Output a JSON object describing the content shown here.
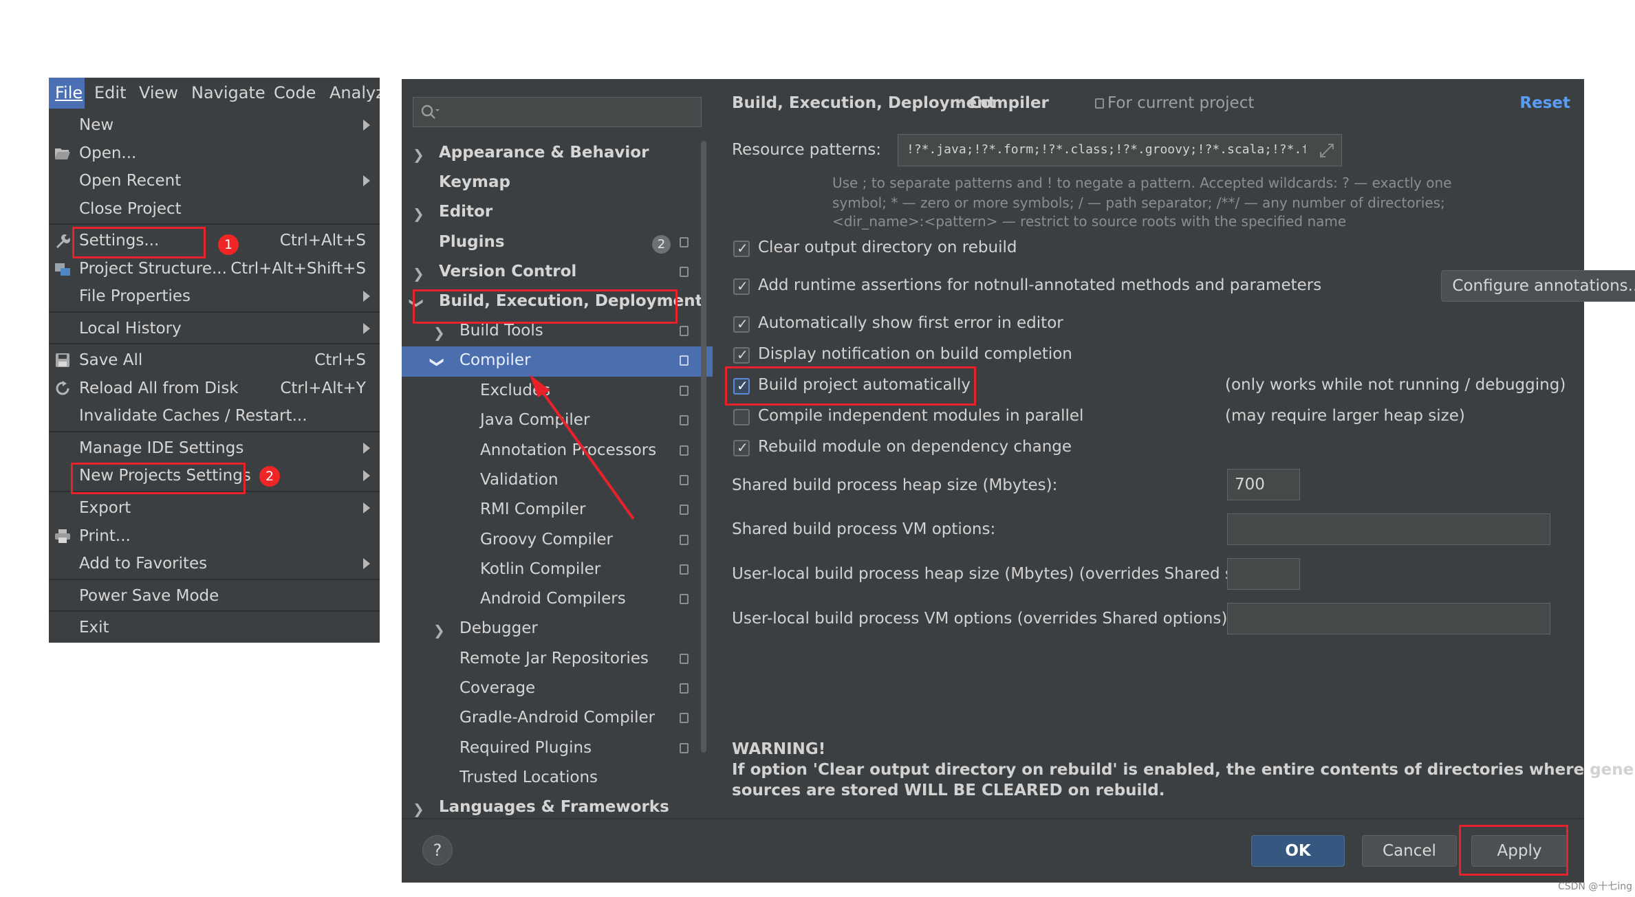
{
  "menu_bar": [
    "File",
    "Edit",
    "View",
    "Navigate",
    "Code",
    "Analyze"
  ],
  "file_menu": {
    "items": {
      "new": "New",
      "open": "Open...",
      "open_recent": "Open Recent",
      "close_project": "Close Project",
      "settings": "Settings...",
      "settings_shortcut": "Ctrl+Alt+S",
      "project_structure": "Project Structure...",
      "project_structure_shortcut": "Ctrl+Alt+Shift+S",
      "file_properties": "File Properties",
      "local_history": "Local History",
      "save_all": "Save All",
      "save_all_shortcut": "Ctrl+S",
      "reload": "Reload All from Disk",
      "reload_shortcut": "Ctrl+Alt+Y",
      "invalidate": "Invalidate Caches / Restart...",
      "manage_ide": "Manage IDE Settings",
      "new_projects": "New Projects Settings",
      "export": "Export",
      "print": "Print...",
      "favorites": "Add to Favorites",
      "power_save": "Power Save Mode",
      "exit": "Exit"
    },
    "badges": [
      "1",
      "2"
    ]
  },
  "tree": {
    "appearance": "Appearance & Behavior",
    "keymap": "Keymap",
    "editor": "Editor",
    "plugins": "Plugins",
    "plugins_badge": "2",
    "vcs": "Version Control",
    "build": "Build, Execution, Deployment",
    "build_tools": "Build Tools",
    "compiler": "Compiler",
    "excludes": "Excludes",
    "java_compiler": "Java Compiler",
    "annotation": "Annotation Processors",
    "validation": "Validation",
    "rmi": "RMI Compiler",
    "groovy": "Groovy Compiler",
    "kotlin": "Kotlin Compiler",
    "android": "Android Compilers",
    "debugger": "Debugger",
    "remote_jar": "Remote Jar Repositories",
    "coverage": "Coverage",
    "gradle_android": "Gradle-Android Compiler",
    "required_plugins": "Required Plugins",
    "trusted": "Trusted Locations",
    "languages": "Languages & Frameworks"
  },
  "header": {
    "crumb1": "Build, Execution, Deployment",
    "sep": "›",
    "crumb2": "Compiler",
    "scope": "For current project",
    "reset": "Reset"
  },
  "compiler": {
    "resource_label": "Resource patterns:",
    "resource_value": "!?*.java;!?*.form;!?*.class;!?*.groovy;!?*.scala;!?*.flex;!?*.kt;!?*.clj;!?*.aj",
    "hint_line1": "Use ; to separate patterns and ! to negate a pattern. Accepted wildcards: ? — exactly one",
    "hint_line2": "symbol; * — zero or more symbols; / — path separator; /**/ — any number of directories;",
    "hint_line3": "<dir_name>:<pattern> — restrict to source roots with the specified name",
    "cb_clear": "Clear output directory on rebuild",
    "cb_assertions": "Add runtime assertions for notnull-annotated methods and parameters",
    "configure_btn": "Configure annotations...",
    "cb_first_error": "Automatically show first error in editor",
    "cb_notification": "Display notification on build completion",
    "cb_build_auto": "Build project automatically",
    "build_auto_note": "(only works while not running / debugging)",
    "cb_parallel": "Compile independent modules in parallel",
    "parallel_note": "(may require larger heap size)",
    "cb_rebuild": "Rebuild module on dependency change",
    "heap_label": "Shared build process heap size (Mbytes):",
    "heap_value": "700",
    "vm_label": "Shared build process VM options:",
    "user_heap_label": "User-local build process heap size (Mbytes) (overrides Shared size):",
    "user_vm_label": "User-local build process VM options (overrides Shared options):",
    "warning_title": "WARNING!",
    "warning_line1": "If option 'Clear output directory on rebuild' is enabled, the entire contents of directories where generated",
    "warning_line2": "sources are stored WILL BE CLEARED on rebuild."
  },
  "footer": {
    "help": "?",
    "ok": "OK",
    "cancel": "Cancel",
    "apply": "Apply"
  },
  "watermark": "CSDN @十七ing",
  "colors": {
    "accent_blue": "#4b6eaf",
    "highlight_red": "#e8212b",
    "reset_link": "#589df6"
  }
}
